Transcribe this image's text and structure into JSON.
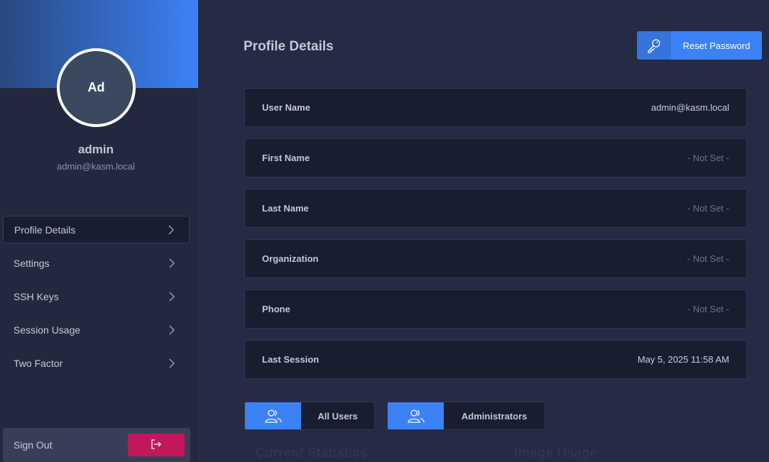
{
  "sidebar": {
    "avatar_initials": "Ad",
    "user_name": "admin",
    "user_email": "admin@kasm.local",
    "nav_items": [
      {
        "label": "Profile Details",
        "active": true
      },
      {
        "label": "Settings",
        "active": false
      },
      {
        "label": "SSH Keys",
        "active": false
      },
      {
        "label": "Session Usage",
        "active": false
      },
      {
        "label": "Two Factor",
        "active": false
      }
    ],
    "sign_out_label": "Sign Out"
  },
  "main": {
    "title": "Profile Details",
    "reset_password_label": "Reset Password",
    "fields": [
      {
        "label": "User Name",
        "value": "admin@kasm.local"
      },
      {
        "label": "First Name",
        "value": "- Not Set -"
      },
      {
        "label": "Last Name",
        "value": "- Not Set -"
      },
      {
        "label": "Organization",
        "value": "- Not Set -"
      },
      {
        "label": "Phone",
        "value": "- Not Set -"
      },
      {
        "label": "Last Session",
        "value": "May 5, 2025 11:58 AM"
      }
    ],
    "groups": [
      {
        "label": "All Users",
        "icon": "users-icon"
      },
      {
        "label": "Administrators",
        "icon": "users-icon"
      }
    ],
    "faded_headings": [
      "Current Statistics",
      "Image Usage"
    ]
  },
  "colors": {
    "accent": "#3b82f6",
    "sign_out": "#c2185b",
    "background": "#252a45",
    "card": "#181d30"
  }
}
